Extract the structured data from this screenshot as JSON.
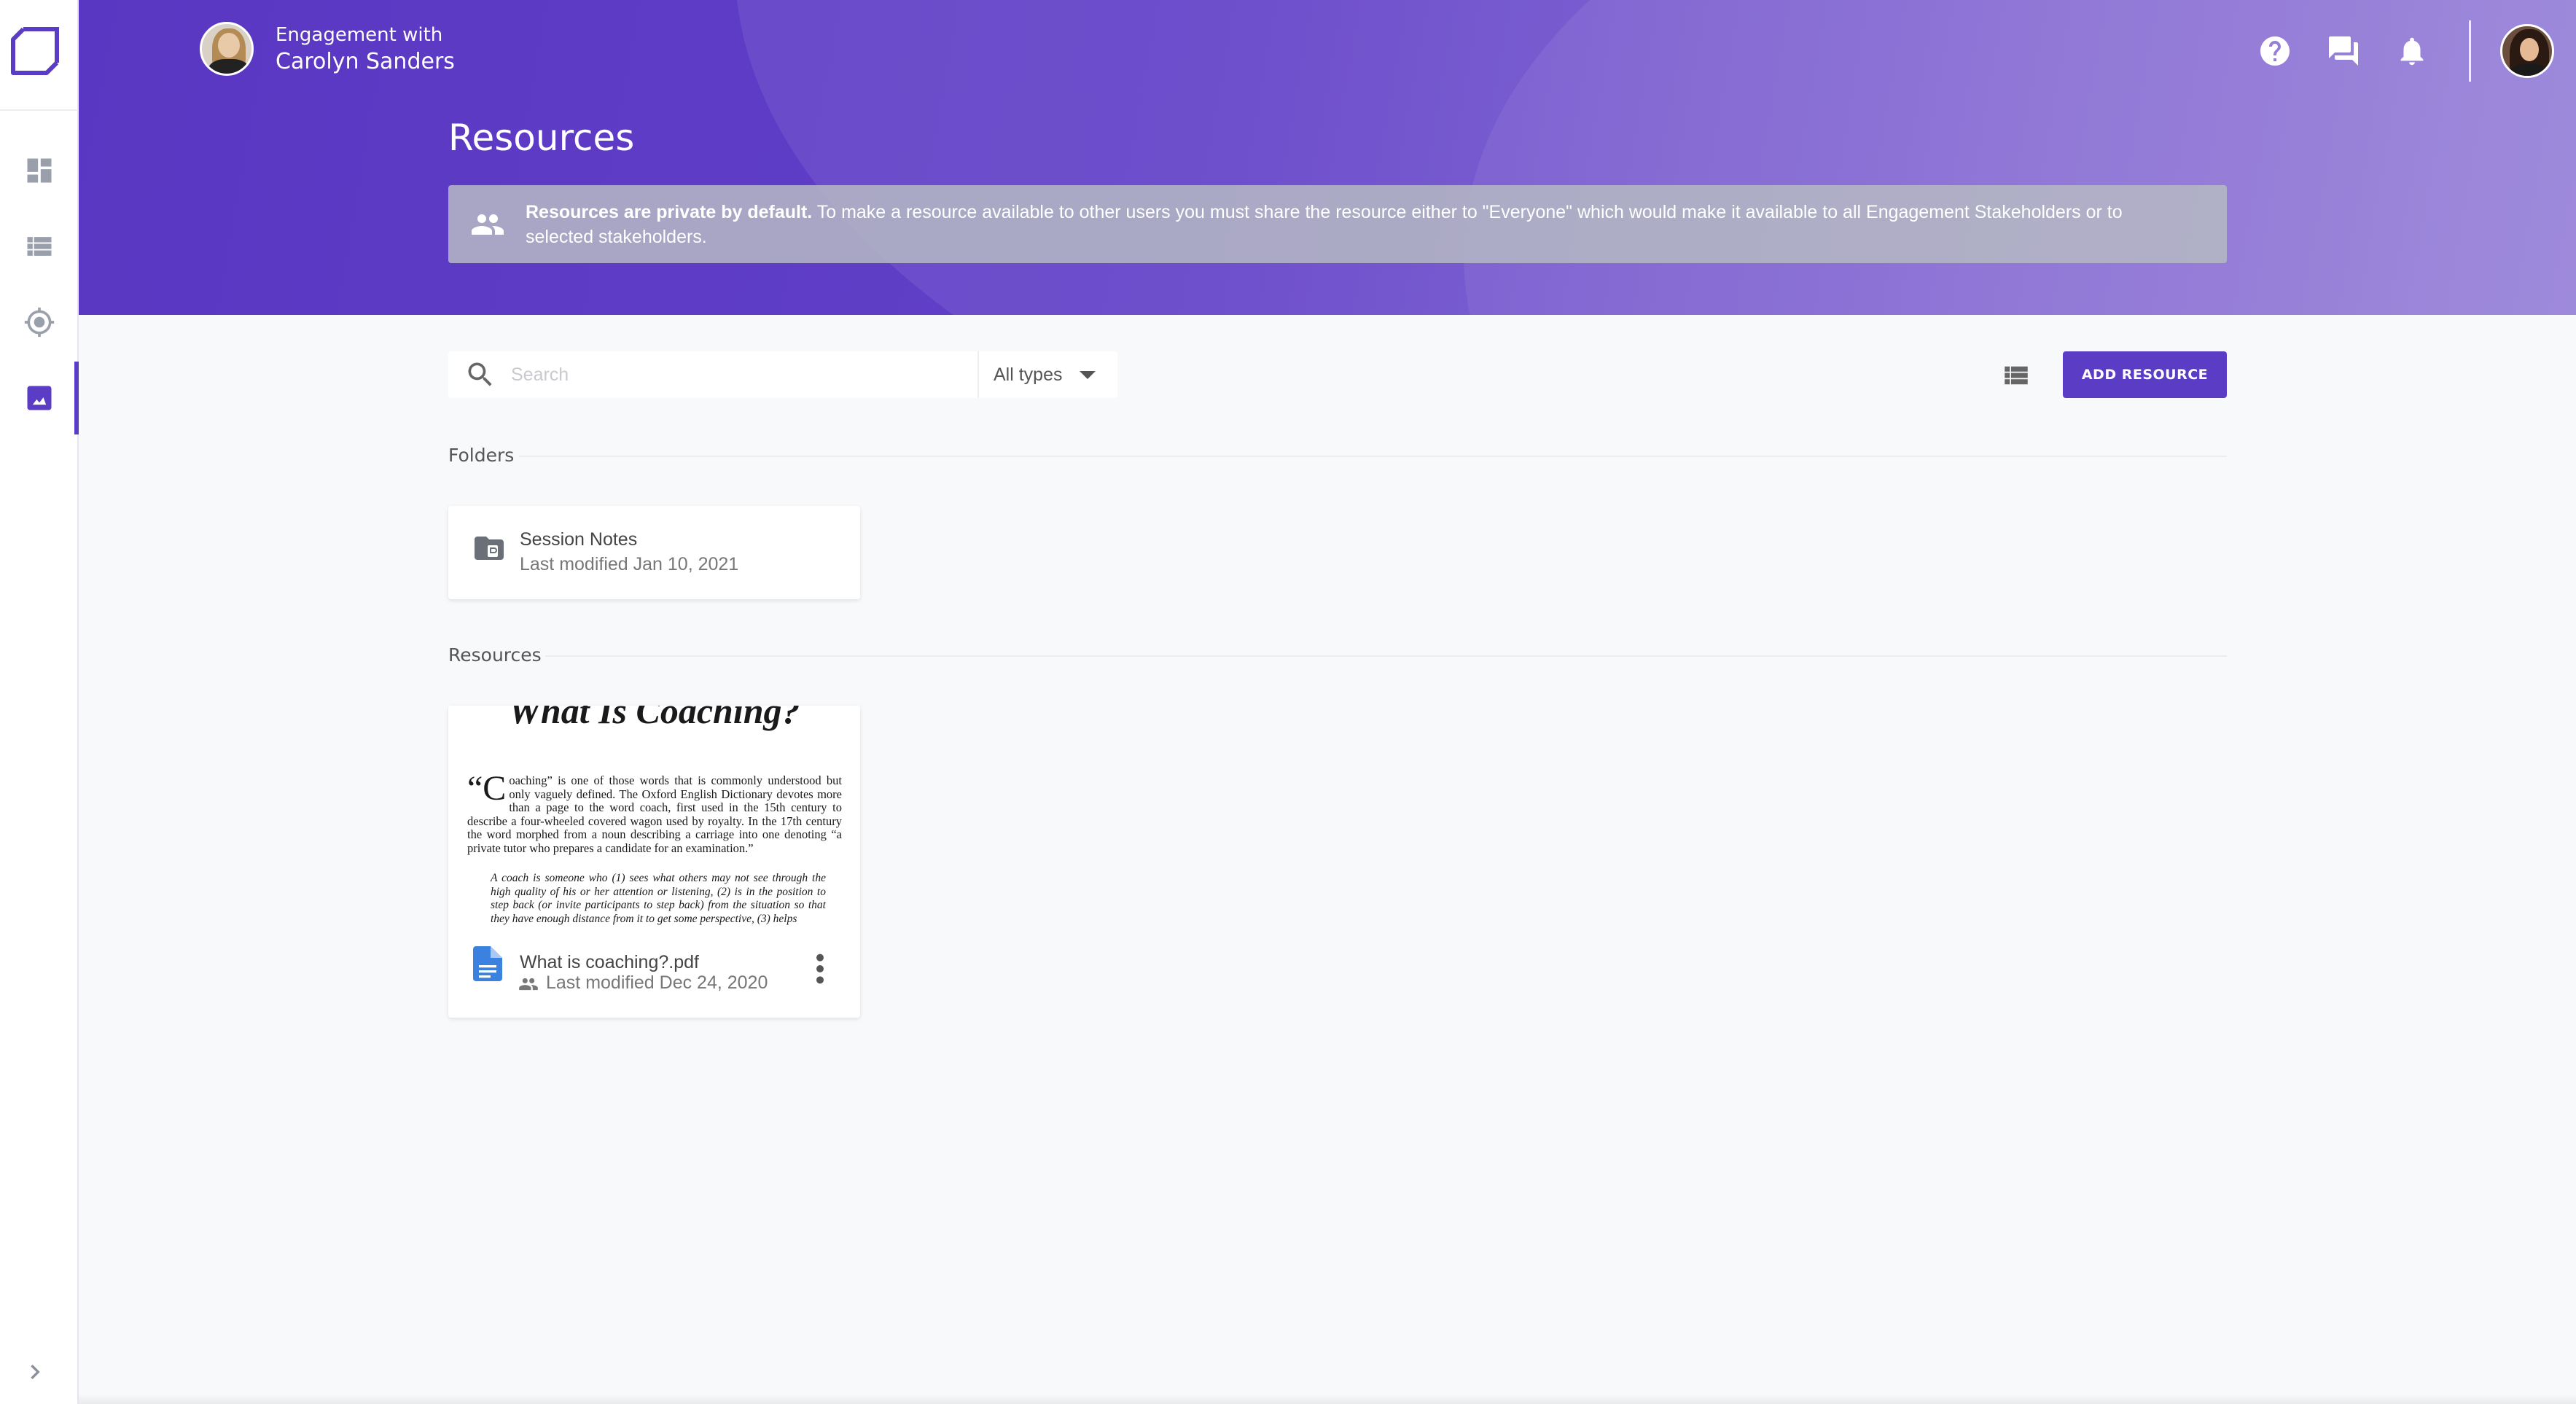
{
  "header": {
    "engagement_sub": "Engagement with",
    "engagement_name": "Carolyn Sanders",
    "page_title": "Resources"
  },
  "top_icons": [
    "help-icon",
    "chat-icon",
    "bell-icon"
  ],
  "banner": {
    "bold": "Resources are private by default.",
    "text": " To make a resource available to other users you must share the resource either to \"Everyone\" which would make it available to all Engagement Stakeholders or to selected stakeholders."
  },
  "toolbar": {
    "search_placeholder": "Search",
    "type_filter": "All types",
    "add_label": "ADD RESOURCE"
  },
  "folders": {
    "label": "Folders",
    "items": [
      {
        "name": "Session Notes",
        "modified": "Last modified Jan 10, 2021"
      }
    ]
  },
  "resources": {
    "label": "Resources",
    "items": [
      {
        "name": "What is coaching?.pdf",
        "modified": "Last modified Dec 24, 2020",
        "preview": {
          "title": "What Is Coaching?",
          "drop_cap": "“C",
          "para": "oaching” is one of those words that is commonly understood but only vaguely defined. The Oxford English Dictionary devotes more than a page to the word coach, first used in the 15th century to describe a four-wheeled covered wagon used by royalty. In the 17th century the word morphed from a noun describing a carriage into one denoting “a private tutor who prepares a candidate for an examination.”",
          "quote": "A coach is someone who (1) sees what others may not see through the high quality of his or her attention or listening, (2) is in the position to step back (or invite participants to step back) from the situation so that they have enough distance from it to get some perspective, (3) helps"
        }
      }
    ]
  },
  "colors": {
    "accent": "#5b3cc4",
    "header_start": "#5a37c2",
    "header_end": "#8f78d6",
    "file_icon": "#3b82e0"
  }
}
